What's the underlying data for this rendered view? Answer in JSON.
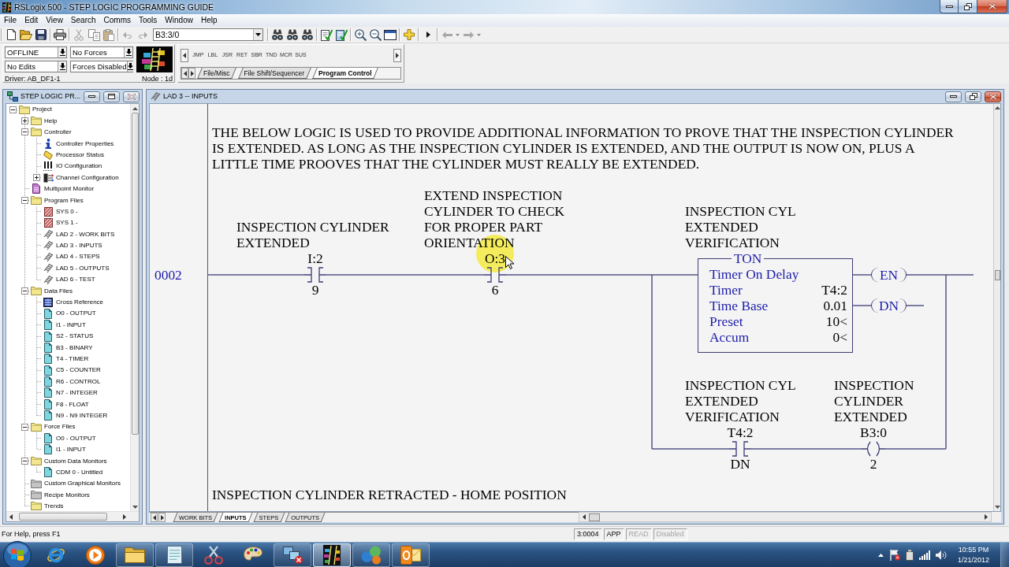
{
  "window": {
    "title": "RSLogix 500 - STEP LOGIC PROGRAMMING GUIDE"
  },
  "menu": [
    "File",
    "Edit",
    "View",
    "Search",
    "Comms",
    "Tools",
    "Window",
    "Help"
  ],
  "toolbar": {
    "address": "B3:3/0"
  },
  "online_bar": {
    "mode": "OFFLINE",
    "forces": "No Forces",
    "edits": "No Edits",
    "force_status": "Forces Disabled",
    "driver": "Driver: AB_DF1-1",
    "node": "Node : 1d"
  },
  "instruction_palette": {
    "instructions": [
      "JMP",
      "LBL",
      "JSR",
      "RET",
      "SBR",
      "TND",
      "MCR",
      "SUS"
    ],
    "tabs": [
      {
        "label": "File/Misc",
        "selected": false
      },
      {
        "label": "File Shift/Sequencer",
        "selected": false
      },
      {
        "label": "Program Control",
        "selected": true
      }
    ]
  },
  "project_window": {
    "title": "STEP LOGIC PR...",
    "tree": [
      {
        "label": "Project",
        "kind": "folder",
        "expanded": true,
        "children": [
          {
            "label": "Help",
            "kind": "folder",
            "expanded": false
          },
          {
            "label": "Controller",
            "kind": "folder",
            "expanded": true,
            "children": [
              {
                "label": "Controller Properties",
                "kind": "info"
              },
              {
                "label": "Processor Status",
                "kind": "processor"
              },
              {
                "label": "IO Configuration",
                "kind": "io"
              },
              {
                "label": "Channel Configuration",
                "kind": "channel",
                "expanded": false
              }
            ]
          },
          {
            "label": "Multipoint Monitor",
            "kind": "monitor"
          },
          {
            "label": "Program Files",
            "kind": "folder",
            "expanded": true,
            "children": [
              {
                "label": "SYS 0 -",
                "kind": "system"
              },
              {
                "label": "SYS 1 -",
                "kind": "system"
              },
              {
                "label": "LAD 2 - WORK BITS",
                "kind": "ladder"
              },
              {
                "label": "LAD 3 - INPUTS",
                "kind": "ladder"
              },
              {
                "label": "LAD 4 - STEPS",
                "kind": "ladder"
              },
              {
                "label": "LAD 5 - OUTPUTS",
                "kind": "ladder"
              },
              {
                "label": "LAD 6 - TEST",
                "kind": "ladder"
              }
            ]
          },
          {
            "label": "Data Files",
            "kind": "folder",
            "expanded": true,
            "children": [
              {
                "label": "Cross Reference",
                "kind": "crossref"
              },
              {
                "label": "O0 - OUTPUT",
                "kind": "data"
              },
              {
                "label": "I1 - INPUT",
                "kind": "data"
              },
              {
                "label": "S2 - STATUS",
                "kind": "data"
              },
              {
                "label": "B3 - BINARY",
                "kind": "data"
              },
              {
                "label": "T4 - TIMER",
                "kind": "data"
              },
              {
                "label": "C5 - COUNTER",
                "kind": "data"
              },
              {
                "label": "R6 - CONTROL",
                "kind": "data"
              },
              {
                "label": "N7 - INTEGER",
                "kind": "data"
              },
              {
                "label": "F8 - FLOAT",
                "kind": "data"
              },
              {
                "label": "N9 - N9 INTEGER",
                "kind": "data"
              }
            ]
          },
          {
            "label": "Force Files",
            "kind": "folder",
            "expanded": true,
            "children": [
              {
                "label": "O0 - OUTPUT",
                "kind": "data"
              },
              {
                "label": "I1 - INPUT",
                "kind": "data"
              }
            ]
          },
          {
            "label": "Custom Data Monitors",
            "kind": "folder",
            "expanded": true,
            "children": [
              {
                "label": "CDM 0 - Untitled",
                "kind": "data"
              }
            ]
          },
          {
            "label": "Custom Graphical Monitors",
            "kind": "folder_grey"
          },
          {
            "label": "Recipe Monitors",
            "kind": "folder_grey"
          },
          {
            "label": "Trends",
            "kind": "folder"
          }
        ]
      }
    ]
  },
  "ladder_window": {
    "title": "LAD 3 -- INPUTS",
    "comment": "THE BELOW LOGIC IS USED TO PROVIDE ADDITIONAL INFORMATION TO PROVE THAT THE INSPECTION CYLINDER IS EXTENDED. AS LONG AS THE INSPECTION CYLINDER IS EXTENDED, AND THE OUTPUT IS NOW ON, PLUS A LITTLE TIME PROOVES THAT THE CYLINDER MUST REALLY BE EXTENDED.",
    "rung": {
      "number": "0002",
      "main": [
        {
          "kind": "contact",
          "description": "INSPECTION CYLINDER EXTENDED",
          "address": "I:2",
          "bit": "9"
        },
        {
          "kind": "contact",
          "description": "EXTEND INSPECTION CYLINDER TO CHECK FOR PROPER PART ORIENTATION",
          "address": "O:3",
          "bit": "6"
        }
      ],
      "timer": {
        "description": "INSPECTION CYL EXTENDED VERIFICATION",
        "mnemonic": "TON",
        "title": "Timer On Delay",
        "fields": [
          {
            "label": "Timer",
            "value": "T4:2"
          },
          {
            "label": "Time Base",
            "value": "0.01"
          },
          {
            "label": "Preset",
            "value": "10<"
          },
          {
            "label": "Accum",
            "value": "0<"
          }
        ],
        "outputs": [
          "EN",
          "DN"
        ]
      },
      "branch": [
        {
          "kind": "contact",
          "description": "INSPECTION CYL EXTENDED VERIFICATION",
          "address": "T4:2",
          "bit": "DN"
        },
        {
          "kind": "coil",
          "description": "INSPECTION CYLINDER EXTENDED",
          "address": "B3:0",
          "bit": "2"
        }
      ]
    },
    "next_comment": "INSPECTION CYLINDER RETRACTED - HOME POSITION",
    "tabs": [
      {
        "label": "WORK BITS",
        "selected": false
      },
      {
        "label": "INPUTS",
        "selected": true
      },
      {
        "label": "STEPS",
        "selected": false
      },
      {
        "label": "OUTPUTS",
        "selected": false
      }
    ]
  },
  "status_bar": {
    "help": "For Help, press F1",
    "panels": [
      {
        "text": "3:0004",
        "disabled": false
      },
      {
        "text": "APP",
        "disabled": false
      },
      {
        "text": "READ",
        "disabled": true
      },
      {
        "text": "Disabled",
        "disabled": true
      }
    ]
  },
  "taskbar": {
    "apps": [
      {
        "kind": "browser",
        "running": false,
        "selected": false
      },
      {
        "kind": "media",
        "running": false,
        "selected": false
      },
      {
        "kind": "explorer",
        "running": true,
        "selected": false
      },
      {
        "kind": "notepad",
        "running": true,
        "selected": false
      },
      {
        "kind": "snip",
        "running": false,
        "selected": false
      },
      {
        "kind": "paint",
        "running": false,
        "selected": false
      },
      {
        "kind": "computers",
        "running": true,
        "selected": false
      },
      {
        "kind": "ladderapp",
        "running": true,
        "selected": true
      },
      {
        "kind": "circles",
        "running": true,
        "selected": false
      },
      {
        "kind": "mail",
        "running": true,
        "selected": false
      }
    ],
    "clock": {
      "time": "10:55 PM",
      "date": "1/21/2012"
    }
  }
}
